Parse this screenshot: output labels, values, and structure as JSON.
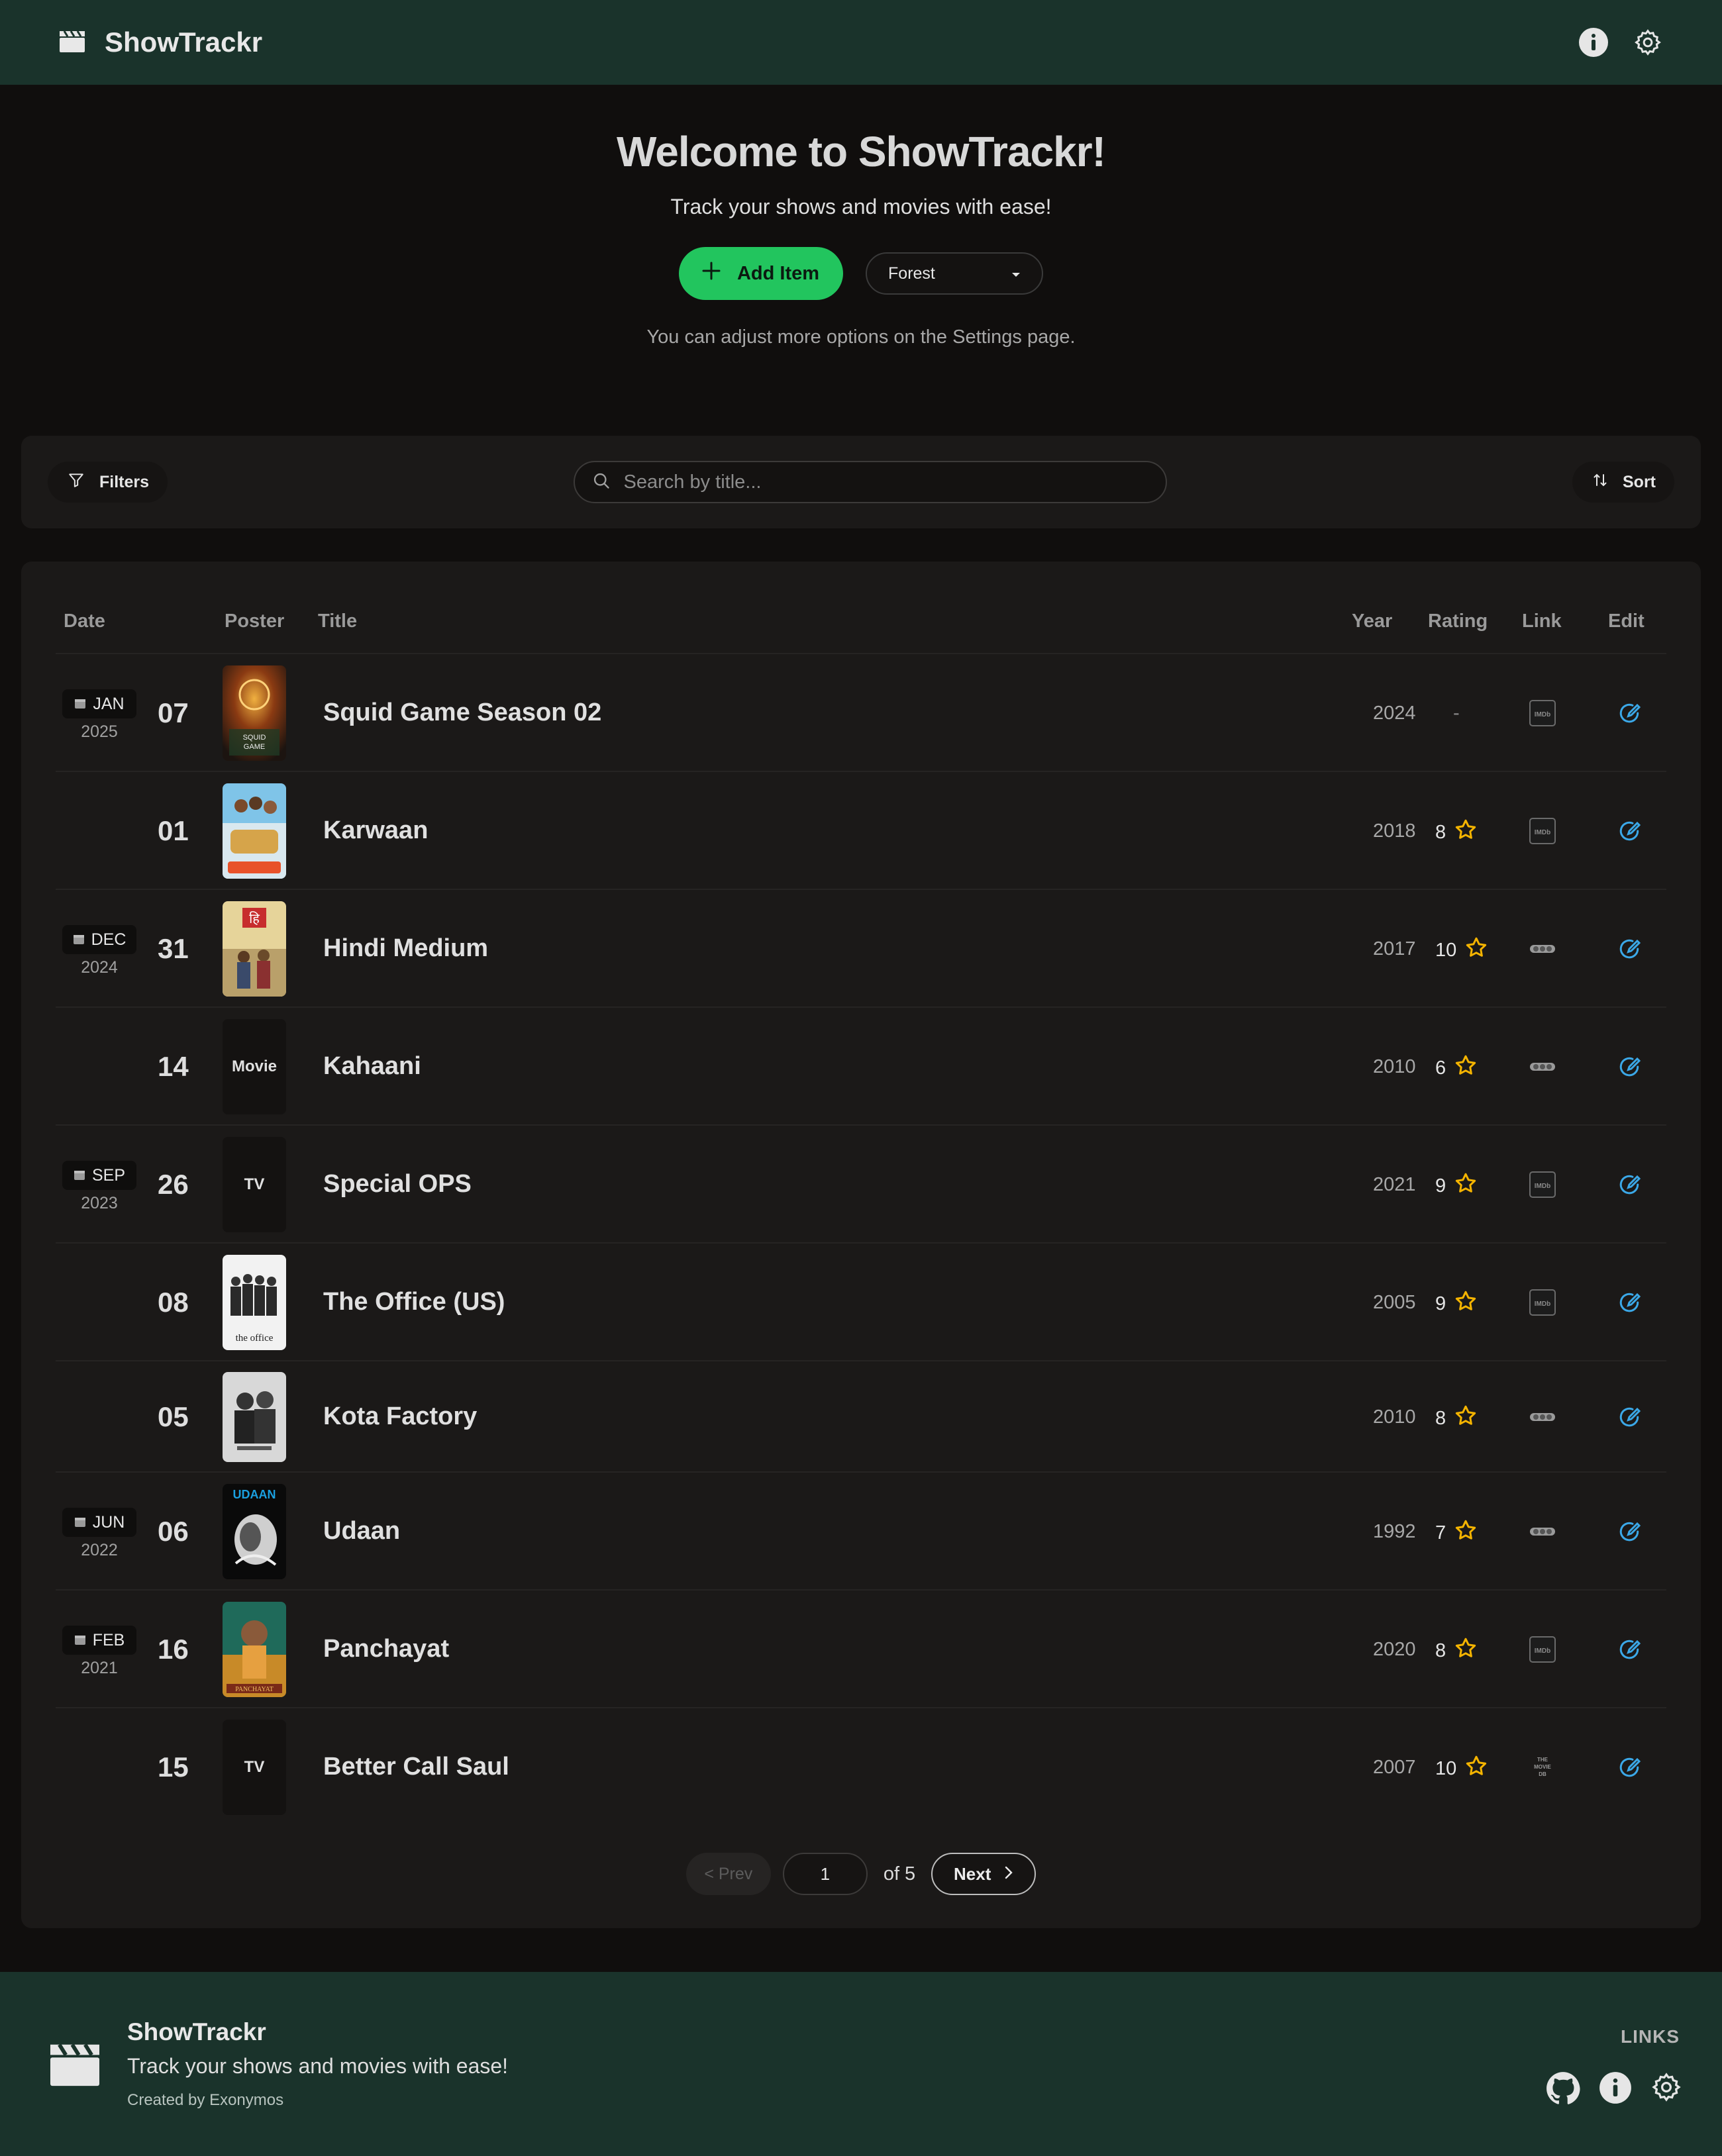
{
  "app": {
    "name": "ShowTrackr"
  },
  "hero": {
    "title": "Welcome to ShowTrackr!",
    "subtitle": "Track your shows and movies with ease!",
    "add_label": "Add Item",
    "theme_value": "Forest",
    "hint": "You can adjust more options on the Settings page."
  },
  "toolbar": {
    "filters_label": "Filters",
    "search_placeholder": "Search by title...",
    "sort_label": "Sort"
  },
  "table": {
    "headers": {
      "date": "Date",
      "poster": "Poster",
      "title": "Title",
      "year": "Year",
      "rating": "Rating",
      "link": "Link",
      "edit": "Edit"
    },
    "rows": [
      {
        "month": "JAN",
        "year_label": "2025",
        "day": "07",
        "poster": "squid",
        "title": "Squid Game Season 02",
        "year": "2024",
        "rating": "-",
        "link": "imdb"
      },
      {
        "month": "",
        "year_label": "",
        "day": "01",
        "poster": "karwaan",
        "title": "Karwaan",
        "year": "2018",
        "rating": "8",
        "link": "imdb"
      },
      {
        "month": "DEC",
        "year_label": "2024",
        "day": "31",
        "poster": "hindi",
        "title": "Hindi Medium",
        "year": "2017",
        "rating": "10",
        "link": "dots"
      },
      {
        "month": "",
        "year_label": "",
        "day": "14",
        "poster": "Movie",
        "title": "Kahaani",
        "year": "2010",
        "rating": "6",
        "link": "dots"
      },
      {
        "month": "SEP",
        "year_label": "2023",
        "day": "26",
        "poster": "TV",
        "title": "Special OPS",
        "year": "2021",
        "rating": "9",
        "link": "imdb"
      },
      {
        "month": "",
        "year_label": "",
        "day": "08",
        "poster": "office",
        "title": "The Office (US)",
        "year": "2005",
        "rating": "9",
        "link": "imdb"
      },
      {
        "month": "",
        "year_label": "",
        "day": "05",
        "poster": "kota",
        "title": "Kota Factory",
        "year": "2010",
        "rating": "8",
        "link": "dots"
      },
      {
        "month": "JUN",
        "year_label": "2022",
        "day": "06",
        "poster": "udaan",
        "title": "Udaan",
        "year": "1992",
        "rating": "7",
        "link": "dots"
      },
      {
        "month": "FEB",
        "year_label": "2021",
        "day": "16",
        "poster": "panchayat",
        "title": "Panchayat",
        "year": "2020",
        "rating": "8",
        "link": "imdb"
      },
      {
        "month": "",
        "year_label": "",
        "day": "15",
        "poster": "TV",
        "title": "Better Call Saul",
        "year": "2007",
        "rating": "10",
        "link": "tmdb"
      }
    ]
  },
  "pagination": {
    "prev_label": "< Prev",
    "current": "1",
    "of_label": "of 5",
    "next_label": "Next"
  },
  "footer": {
    "name": "ShowTrackr",
    "tagline": "Track your shows and movies with ease!",
    "credit": "Created by Exonymos",
    "links_label": "LINKS"
  },
  "colors": {
    "header_bg": "#1a332b",
    "accent": "#22c55e",
    "star": "#f5b400",
    "edit": "#3ba8e8"
  },
  "icons": [
    "clapperboard-icon",
    "info-icon",
    "gear-icon",
    "plus-icon",
    "chevron-down-icon",
    "filter-icon",
    "search-icon",
    "sort-icon",
    "calendar-icon",
    "star-icon",
    "imdb-icon",
    "more-dots-icon",
    "tmdb-icon",
    "edit-icon",
    "chevron-right-icon",
    "github-icon"
  ]
}
